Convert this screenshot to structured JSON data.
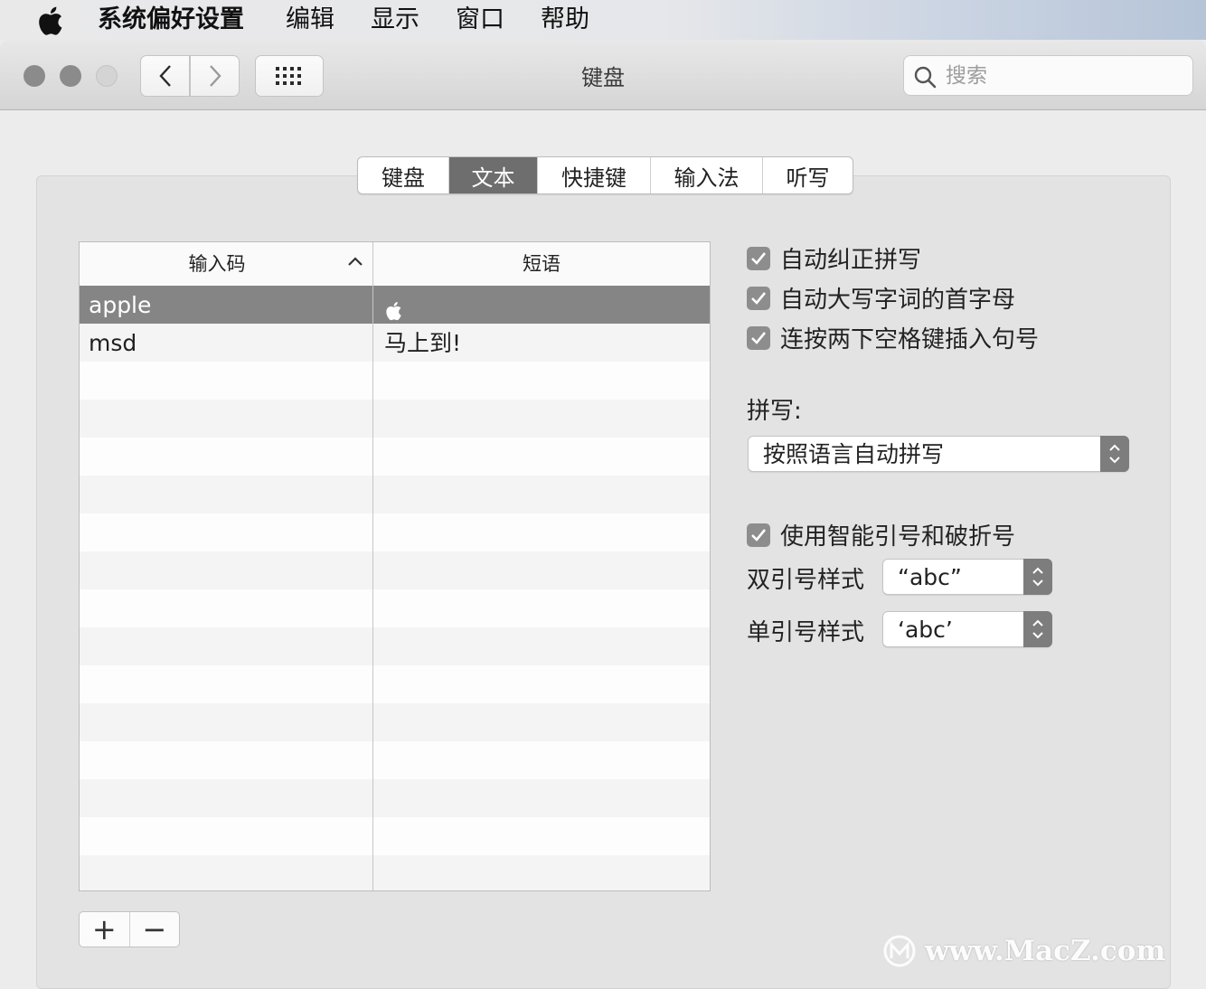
{
  "menubar": {
    "app_name": "系统偏好设置",
    "items": [
      "编辑",
      "显示",
      "窗口",
      "帮助"
    ]
  },
  "window": {
    "title": "键盘",
    "search_placeholder": "搜索"
  },
  "tabs": [
    {
      "label": "键盘",
      "active": false
    },
    {
      "label": "文本",
      "active": true
    },
    {
      "label": "快捷键",
      "active": false
    },
    {
      "label": "输入法",
      "active": false
    },
    {
      "label": "听写",
      "active": false
    }
  ],
  "table": {
    "columns": [
      "输入码",
      "短语"
    ],
    "rows": [
      {
        "code": "apple",
        "phrase": "apple-logo",
        "selected": true
      },
      {
        "code": "msd",
        "phrase": "马上到!",
        "selected": false
      }
    ],
    "add_label": "+",
    "remove_label": "−"
  },
  "options": {
    "auto_correct": {
      "label": "自动纠正拼写",
      "checked": true
    },
    "auto_capitalize": {
      "label": "自动大写字词的首字母",
      "checked": true
    },
    "double_space_period": {
      "label": "连按两下空格键插入句号",
      "checked": true
    },
    "spelling_label": "拼写:",
    "spelling_value": "按照语言自动拼写",
    "smart_quotes": {
      "label": "使用智能引号和破折号",
      "checked": true
    },
    "double_quote_label": "双引号样式",
    "double_quote_value": "“abc”",
    "single_quote_label": "单引号样式",
    "single_quote_value": "‘abc’"
  },
  "watermark": "www.MacZ.com",
  "colors": {
    "tab_active": "#6e6e6e",
    "row_selected": "#858585",
    "checkbox": "#8d8d8d"
  }
}
